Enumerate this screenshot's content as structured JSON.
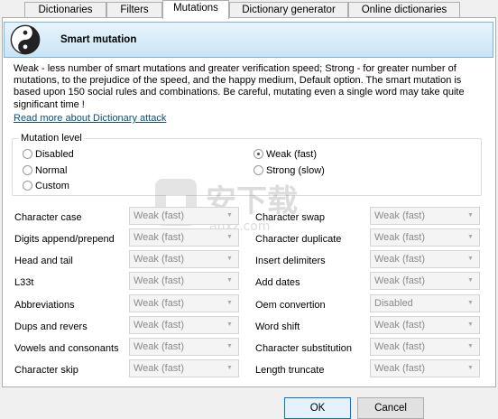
{
  "tabs": [
    {
      "label": "Dictionaries"
    },
    {
      "label": "Filters"
    },
    {
      "label": "Mutations"
    },
    {
      "label": "Dictionary generator"
    },
    {
      "label": "Online dictionaries"
    }
  ],
  "header": {
    "title": "Smart mutation",
    "logo": "yin-yang-icon"
  },
  "description": "Weak - less number of smart mutations and greater verification speed; Strong - for greater number of mutations, to the prejudice of the speed, and the happy medium, Default option. The smart mutation is based upon 150 social rules and combinations. Be careful, mutating even a single word may take quite significant time !",
  "read_more_link": "Read more about Dictionary attack",
  "mutation_level": {
    "title": "Mutation level",
    "options": [
      {
        "label": "Disabled",
        "checked": false
      },
      {
        "label": "Normal",
        "checked": false
      },
      {
        "label": "Custom",
        "checked": false
      },
      {
        "label": "Weak (fast)",
        "checked": true
      },
      {
        "label": "Strong (slow)",
        "checked": false
      }
    ]
  },
  "settings_left": [
    {
      "label": "Character case",
      "value": "Weak (fast)"
    },
    {
      "label": "Digits append/prepend",
      "value": "Weak (fast)"
    },
    {
      "label": "Head and tail",
      "value": "Weak (fast)"
    },
    {
      "label": "L33t",
      "value": "Weak (fast)"
    },
    {
      "label": "Abbreviations",
      "value": "Weak (fast)"
    },
    {
      "label": "Dups and revers",
      "value": "Weak (fast)"
    },
    {
      "label": "Vowels and consonants",
      "value": "Weak (fast)"
    },
    {
      "label": "Character skip",
      "value": "Weak (fast)"
    }
  ],
  "settings_right": [
    {
      "label": "Character swap",
      "value": "Weak (fast)"
    },
    {
      "label": "Character duplicate",
      "value": "Weak (fast)"
    },
    {
      "label": "Insert delimiters",
      "value": "Weak (fast)"
    },
    {
      "label": "Add dates",
      "value": "Weak (fast)"
    },
    {
      "label": "Oem convertion",
      "value": "Disabled"
    },
    {
      "label": "Word shift",
      "value": "Weak (fast)"
    },
    {
      "label": "Character substitution",
      "value": "Weak (fast)"
    },
    {
      "label": "Length truncate",
      "value": "Weak (fast)"
    }
  ],
  "watermark": {
    "text": "安下载",
    "sub": "anxz.com"
  },
  "buttons": {
    "ok": "OK",
    "cancel": "Cancel"
  },
  "colors": {
    "accent": "#0078d7",
    "header_bg": "#c9e4f6",
    "link": "#0b4f7a"
  }
}
